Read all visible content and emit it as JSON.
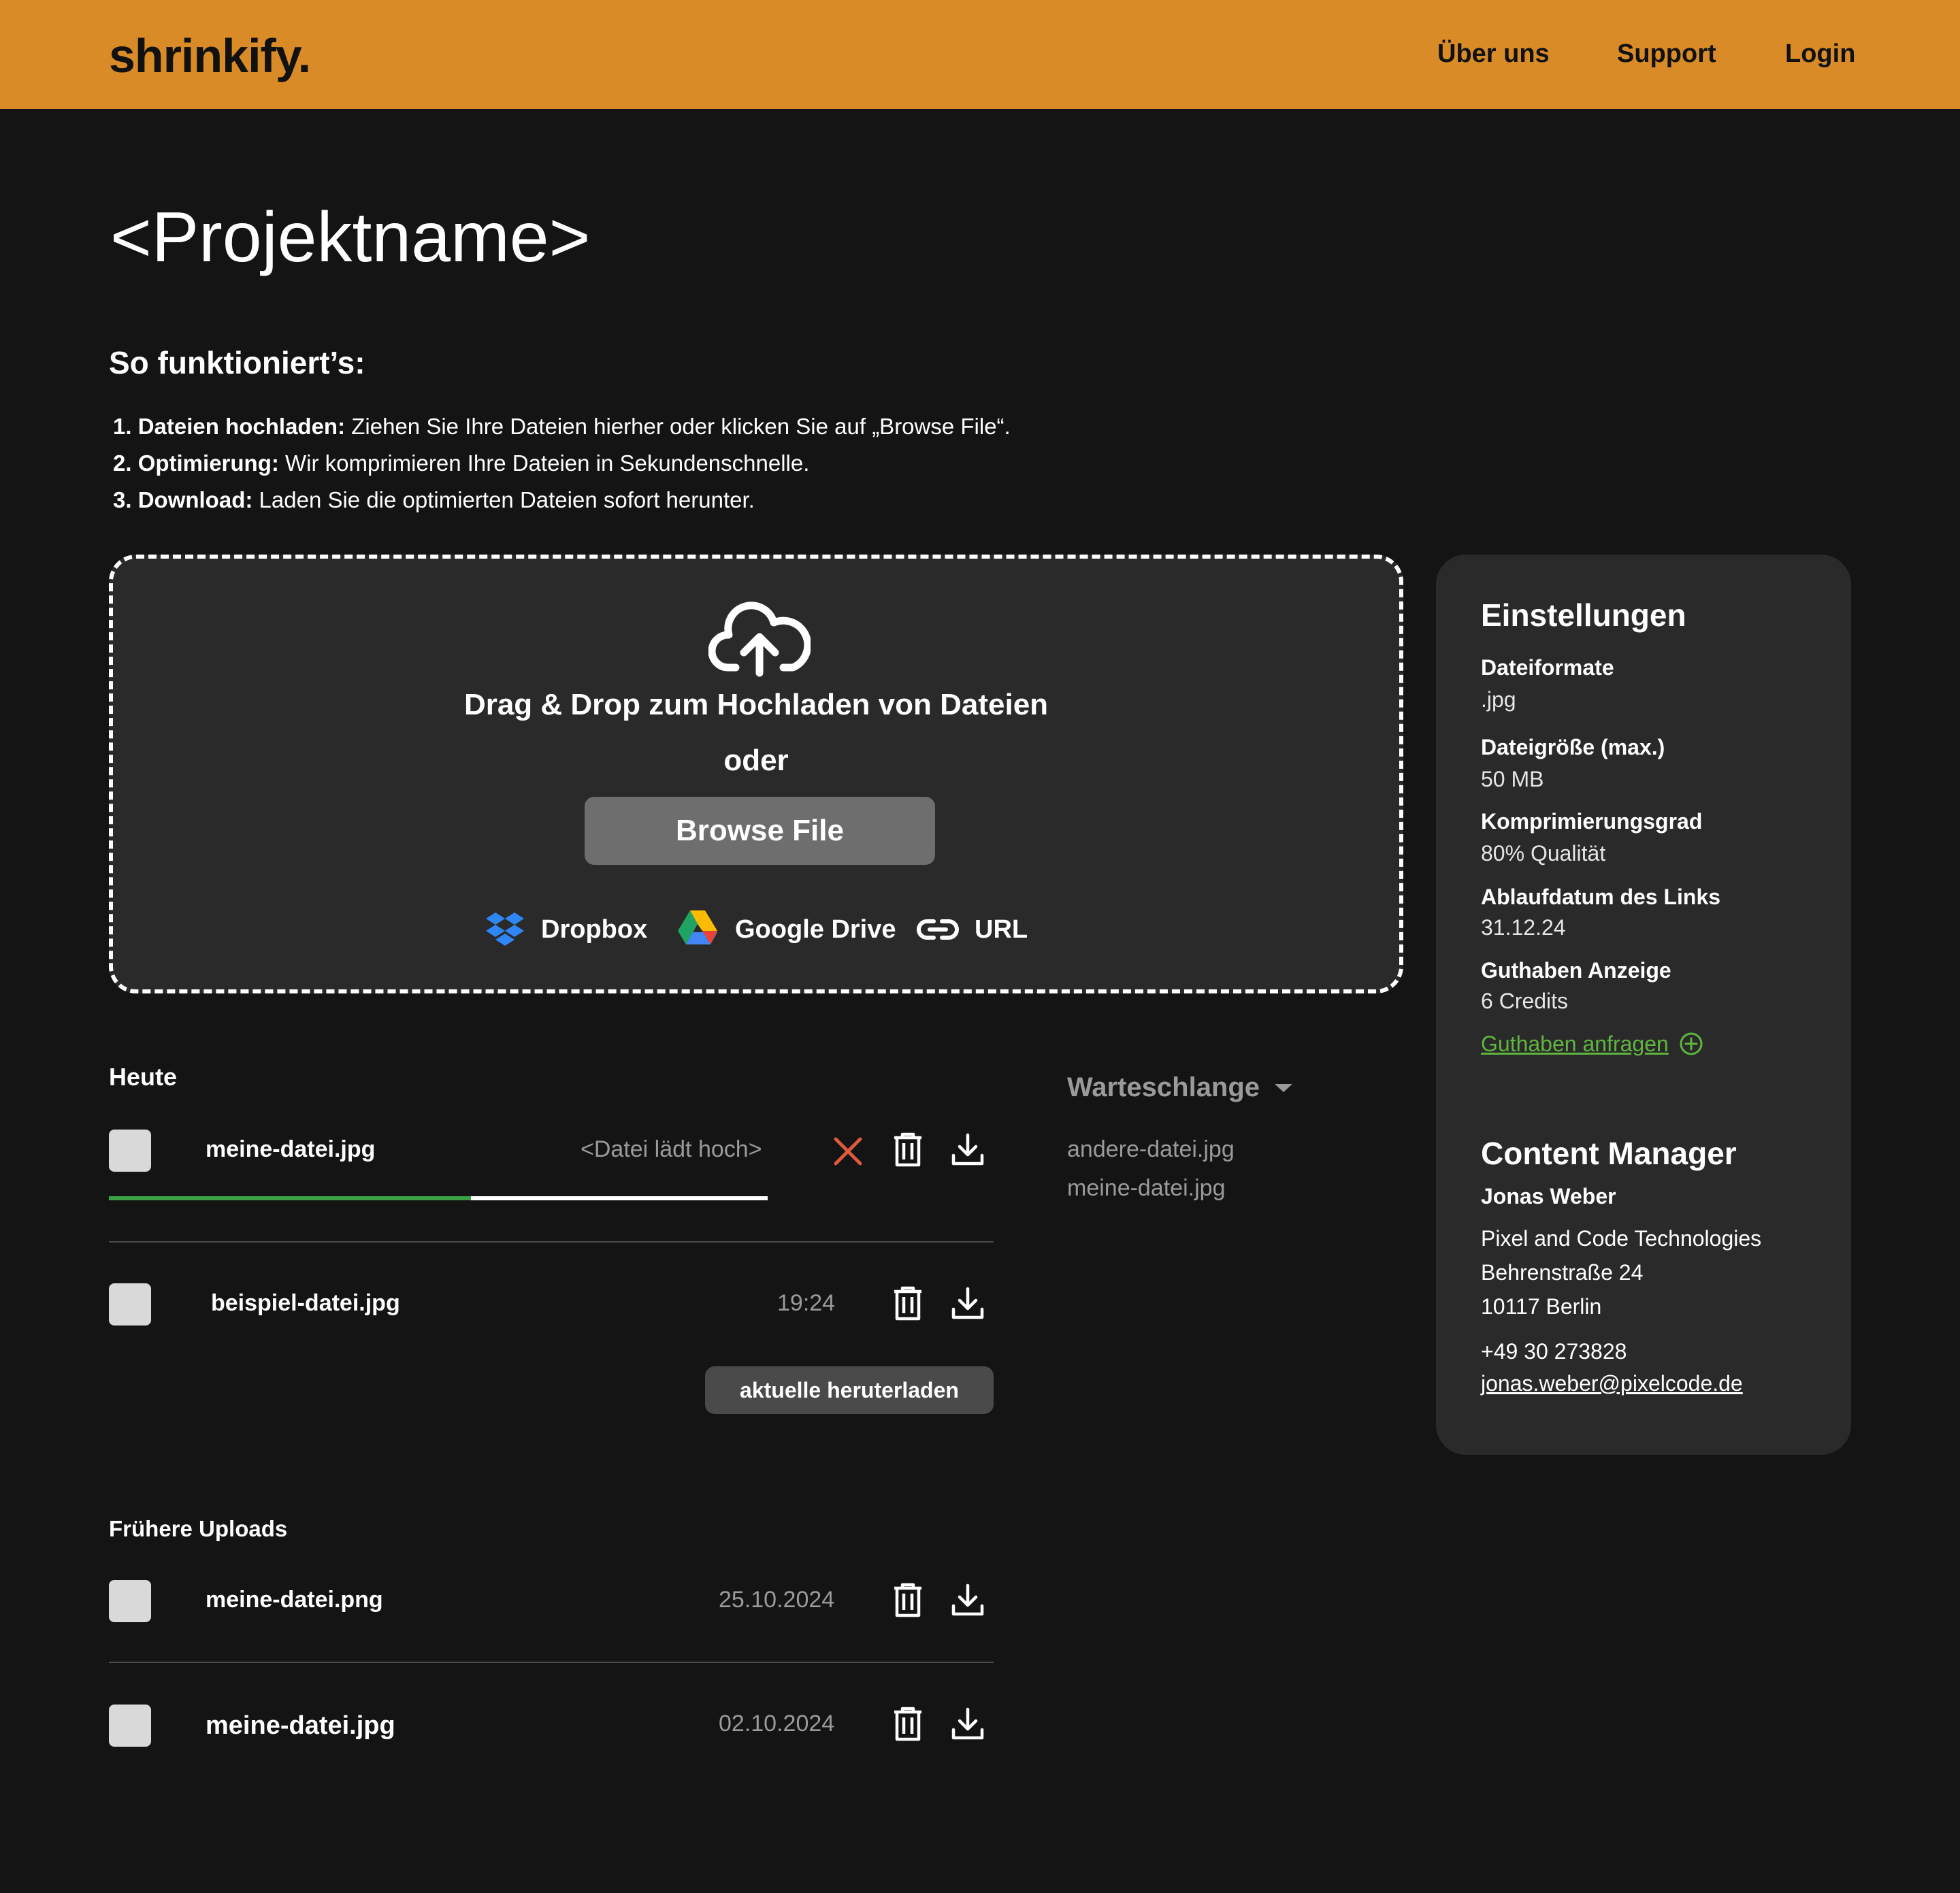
{
  "brand": {
    "logo": "shrinkify.",
    "accent": "#d98b27"
  },
  "nav": {
    "about": "Über uns",
    "support": "Support",
    "login": "Login"
  },
  "page": {
    "title": "<Projektname>"
  },
  "howto": {
    "title": "So funktioniert’s:",
    "steps": [
      {
        "num": "1.",
        "bold": "Dateien hochladen:",
        "text": " Ziehen Sie Ihre Dateien hierher oder klicken Sie auf „Browse File“."
      },
      {
        "num": "2.",
        "bold": "Optimierung:",
        "text": " Wir komprimieren Ihre Dateien in Sekundenschnelle."
      },
      {
        "num": "3.",
        "bold": "Download:",
        "text": " Laden Sie die optimierten Dateien sofort herunter."
      }
    ]
  },
  "dropzone": {
    "icon": "cloud-upload-icon",
    "title": "Drag & Drop zum Hochladen von Dateien",
    "or": "oder",
    "browse": "Browse File",
    "sources": {
      "dropbox": "Dropbox",
      "gdrive": "Google Drive",
      "url": "URL"
    }
  },
  "today": {
    "label": "Heute",
    "uploading": {
      "name": "meine-datei.jpg",
      "status": "<Datei lädt hoch>",
      "progress": 0.55
    },
    "done": {
      "name": "beispiel-datei.jpg",
      "time": "19:24"
    },
    "download_current": "aktuelle heruterladen"
  },
  "earlier": {
    "label": "Frühere Uploads",
    "items": [
      {
        "name": "meine-datei.png",
        "date": "25.10.2024"
      },
      {
        "name": "meine-datei.jpg",
        "date": "02.10.2024"
      }
    ]
  },
  "queue": {
    "title": "Warteschlange",
    "items": [
      "andere-datei.jpg",
      "meine-datei.jpg"
    ]
  },
  "settings": {
    "title": "Einstellungen",
    "formats_label": "Dateiformate",
    "formats_value": ".jpg",
    "size_label": "Dateigröße (max.)",
    "size_value": "50 MB",
    "compression_label": "Komprimierungsgrad",
    "compression_value": "80% Qualität",
    "expiry_label": "Ablaufdatum des Links",
    "expiry_value": "31.12.24",
    "credits_label": "Guthaben Anzeige",
    "credits_value": "6 Credits",
    "request_credits": "Guthaben anfragen"
  },
  "content_manager": {
    "title": "Content Manager",
    "name": "Jonas Weber",
    "company": "Pixel and Code Technologies",
    "street": "Behrenstraße 24",
    "city": "10117 Berlin",
    "phone": "+49 30 273828",
    "email": "jonas.weber@pixelcode.de"
  },
  "colors": {
    "background": "#141414",
    "panel": "#2a2a2a",
    "success": "#3aa043",
    "link": "#5fb53f",
    "cancel": "#e05a3a"
  }
}
